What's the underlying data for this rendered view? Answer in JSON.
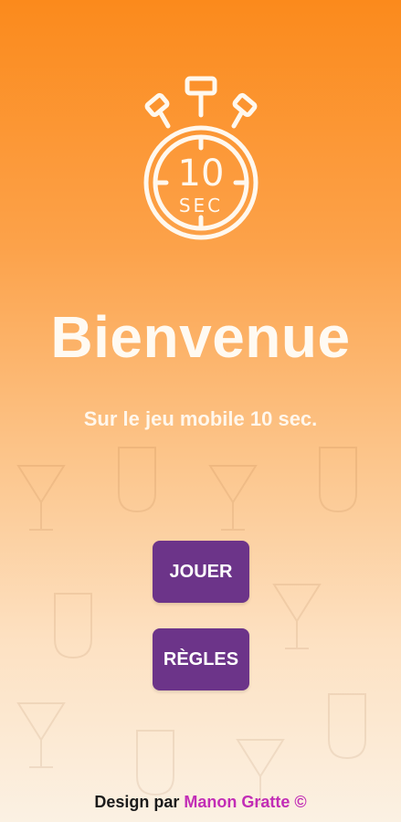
{
  "welcome": {
    "logo_number": "10",
    "logo_unit": "SEC",
    "title": "Bienvenue",
    "subtitle": "Sur le jeu mobile 10 sec."
  },
  "buttons": {
    "play_label": "JOUER",
    "rules_label": "RÈGLES"
  },
  "footer": {
    "prefix": "Design par",
    "author": "Manon Gratte",
    "copyright": "©"
  },
  "colors": {
    "gradient_top": "#fb8a1c",
    "gradient_bottom": "#fbf1e3",
    "button": "#6c3489",
    "author_link": "#c22db6"
  }
}
